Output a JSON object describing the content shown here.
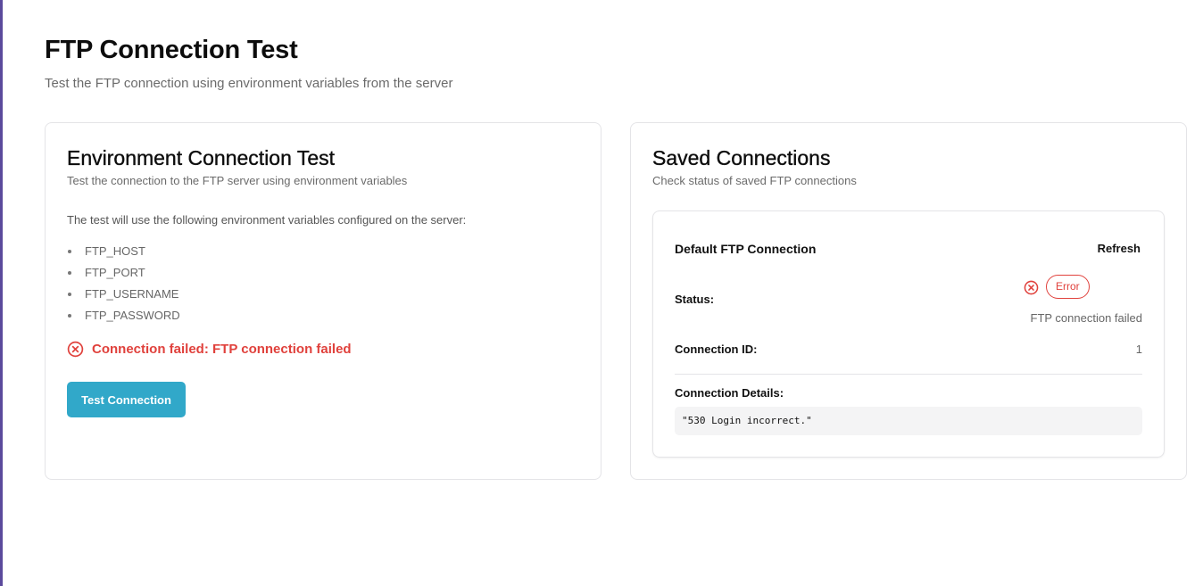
{
  "header": {
    "title": "FTP Connection Test",
    "subtitle": "Test the FTP connection using environment variables from the server"
  },
  "env_card": {
    "title": "Environment Connection Test",
    "description": "Test the connection to the FTP server using environment variables",
    "intro": "The test will use the following environment variables configured on the server:",
    "variables": [
      "FTP_HOST",
      "FTP_PORT",
      "FTP_USERNAME",
      "FTP_PASSWORD"
    ],
    "error_message": "Connection failed: FTP connection failed",
    "test_button_label": "Test Connection"
  },
  "saved_card": {
    "title": "Saved Connections",
    "description": "Check status of saved FTP connections",
    "connection": {
      "name": "Default FTP Connection",
      "refresh_label": "Refresh",
      "status_label": "Status:",
      "status_badge": "Error",
      "status_message": "FTP connection failed",
      "id_label": "Connection ID:",
      "id_value": "1",
      "details_label": "Connection Details:",
      "details_value": "\"530 Login incorrect.\""
    }
  },
  "colors": {
    "accent_bar": "#5b4a9c",
    "primary_button": "#31a8c9",
    "error": "#e0413c"
  },
  "icons": {
    "error": "x-circle-icon"
  }
}
